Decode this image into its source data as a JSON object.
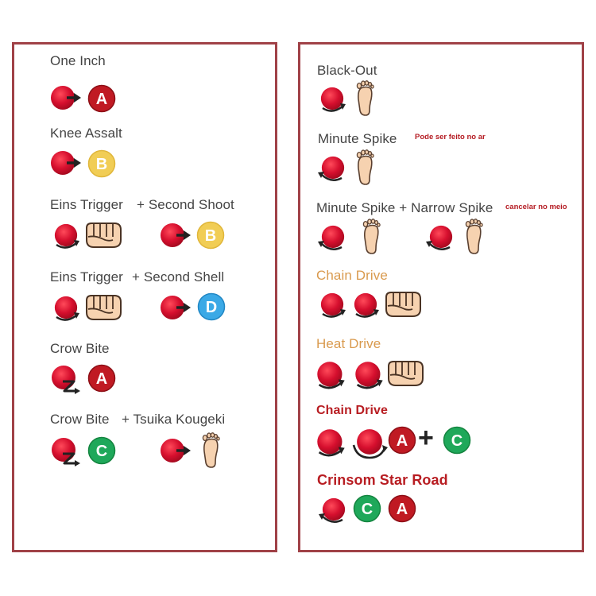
{
  "colors": {
    "frame": "#a04147",
    "button_red": "#d60f2e",
    "button_a": "#c01a23",
    "button_b": "#f1cd55",
    "button_c": "#1fa85a",
    "button_d": "#3ba9e6",
    "title_orange": "#d99a4e",
    "title_red": "#b81d22"
  },
  "left": {
    "moves": [
      {
        "name": "One Inch",
        "inputs": [
          "forward-arrow-icon",
          "button-a-icon"
        ]
      },
      {
        "name": "Knee Assalt",
        "inputs": [
          "forward-arrow-icon",
          "button-b-icon"
        ]
      },
      {
        "name": "Eins Trigger",
        "follow": "+ Second Shoot",
        "inputs": [
          "quarter-circle-icon",
          "fist-icon",
          "forward-arrow-icon",
          "button-b-icon"
        ]
      },
      {
        "name": "Eins Trigger",
        "follow": "+ Second Shell",
        "inputs": [
          "quarter-circle-icon",
          "fist-icon",
          "forward-arrow-icon",
          "button-d-icon"
        ]
      },
      {
        "name": "Crow Bite",
        "inputs": [
          "z-motion-icon",
          "button-a-icon"
        ]
      },
      {
        "name": "Crow Bite",
        "follow": "+ Tsuika Kougeki",
        "inputs": [
          "z-motion-icon",
          "button-c-icon",
          "forward-arrow-icon",
          "foot-icon"
        ]
      }
    ],
    "button_letters": {
      "a": "A",
      "b": "B",
      "c": "C",
      "d": "D"
    }
  },
  "right": {
    "moves": [
      {
        "name": "Black-Out",
        "inputs": [
          "quarter-circle-icon",
          "foot-icon"
        ]
      },
      {
        "name": "Minute Spike",
        "note": "Pode ser feito no ar",
        "inputs": [
          "back-quarter-circle-icon",
          "foot-icon"
        ]
      },
      {
        "name": "Minute Spike + Narrow Spike",
        "note": "cancelar no meio",
        "inputs": [
          "back-quarter-circle-icon",
          "foot-icon",
          "back-quarter-circle-icon",
          "foot-icon"
        ]
      },
      {
        "name": "Chain Drive",
        "inputs": [
          "quarter-circle-icon",
          "quarter-circle-icon",
          "fist-icon"
        ]
      },
      {
        "name": "Heat Drive",
        "inputs": [
          "quarter-circle-icon",
          "quarter-circle-icon",
          "fist-icon"
        ]
      },
      {
        "name": "Chain Drive",
        "inputs": [
          "quarter-circle-icon",
          "half-circle-icon",
          "button-a-icon",
          "button-c-icon"
        ],
        "plus": "+"
      },
      {
        "name": "Crinsom Star Road",
        "inputs": [
          "back-quarter-circle-icon",
          "button-c-icon",
          "button-a-icon"
        ]
      }
    ]
  }
}
